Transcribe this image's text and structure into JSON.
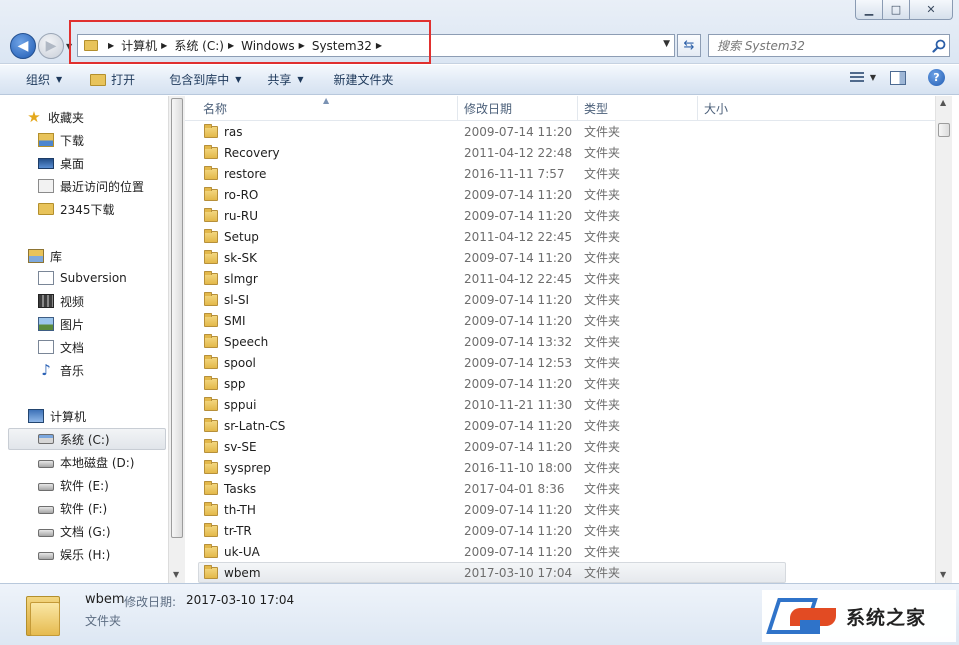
{
  "window": {
    "minimize_glyph": "▁",
    "maximize_glyph": "□",
    "close_glyph": "✕"
  },
  "address": {
    "crumbs": [
      "计算机",
      "系统 (C:)",
      "Windows",
      "System32"
    ]
  },
  "search": {
    "placeholder": "搜索 System32"
  },
  "toolbar": {
    "organize": "组织",
    "open": "打开",
    "include_in_library": "包含到库中",
    "share": "共享",
    "new_folder": "新建文件夹"
  },
  "nav": {
    "favorites": "收藏夹",
    "downloads": "下载",
    "desktop": "桌面",
    "recent": "最近访问的位置",
    "dl2345": "2345下载",
    "libraries": "库",
    "subversion": "Subversion",
    "videos": "视频",
    "pictures": "图片",
    "documents": "文档",
    "music": "音乐",
    "computer": "计算机",
    "drive_c": "系统 (C:)",
    "drive_d": "本地磁盘 (D:)",
    "drive_e": "软件 (E:)",
    "drive_f": "软件 (F:)",
    "drive_g": "文档 (G:)",
    "drive_h": "娱乐 (H:)"
  },
  "columns": {
    "name": "名称",
    "date": "修改日期",
    "type": "类型",
    "size": "大小"
  },
  "files": [
    {
      "name": "ras",
      "date": "2009-07-14 11:20",
      "type": "文件夹"
    },
    {
      "name": "Recovery",
      "date": "2011-04-12 22:48",
      "type": "文件夹"
    },
    {
      "name": "restore",
      "date": "2016-11-11 7:57",
      "type": "文件夹"
    },
    {
      "name": "ro-RO",
      "date": "2009-07-14 11:20",
      "type": "文件夹"
    },
    {
      "name": "ru-RU",
      "date": "2009-07-14 11:20",
      "type": "文件夹"
    },
    {
      "name": "Setup",
      "date": "2011-04-12 22:45",
      "type": "文件夹"
    },
    {
      "name": "sk-SK",
      "date": "2009-07-14 11:20",
      "type": "文件夹"
    },
    {
      "name": "slmgr",
      "date": "2011-04-12 22:45",
      "type": "文件夹"
    },
    {
      "name": "sl-SI",
      "date": "2009-07-14 11:20",
      "type": "文件夹"
    },
    {
      "name": "SMI",
      "date": "2009-07-14 11:20",
      "type": "文件夹"
    },
    {
      "name": "Speech",
      "date": "2009-07-14 13:32",
      "type": "文件夹"
    },
    {
      "name": "spool",
      "date": "2009-07-14 12:53",
      "type": "文件夹"
    },
    {
      "name": "spp",
      "date": "2009-07-14 11:20",
      "type": "文件夹"
    },
    {
      "name": "sppui",
      "date": "2010-11-21 11:30",
      "type": "文件夹"
    },
    {
      "name": "sr-Latn-CS",
      "date": "2009-07-14 11:20",
      "type": "文件夹"
    },
    {
      "name": "sv-SE",
      "date": "2009-07-14 11:20",
      "type": "文件夹"
    },
    {
      "name": "sysprep",
      "date": "2016-11-10 18:00",
      "type": "文件夹"
    },
    {
      "name": "Tasks",
      "date": "2017-04-01 8:36",
      "type": "文件夹"
    },
    {
      "name": "th-TH",
      "date": "2009-07-14 11:20",
      "type": "文件夹"
    },
    {
      "name": "tr-TR",
      "date": "2009-07-14 11:20",
      "type": "文件夹"
    },
    {
      "name": "uk-UA",
      "date": "2009-07-14 11:20",
      "type": "文件夹"
    },
    {
      "name": "wbem",
      "date": "2017-03-10 17:04",
      "type": "文件夹"
    }
  ],
  "selected_index": 21,
  "details": {
    "name": "wbem",
    "modified_label": "修改日期:",
    "modified_value": "2017-03-10 17:04",
    "type": "文件夹"
  },
  "watermark": {
    "text": "系统之家"
  },
  "colors": {
    "highlight_box": "#e0302f",
    "folder": "#e3b84a",
    "toolbar_text": "#1e395b"
  }
}
